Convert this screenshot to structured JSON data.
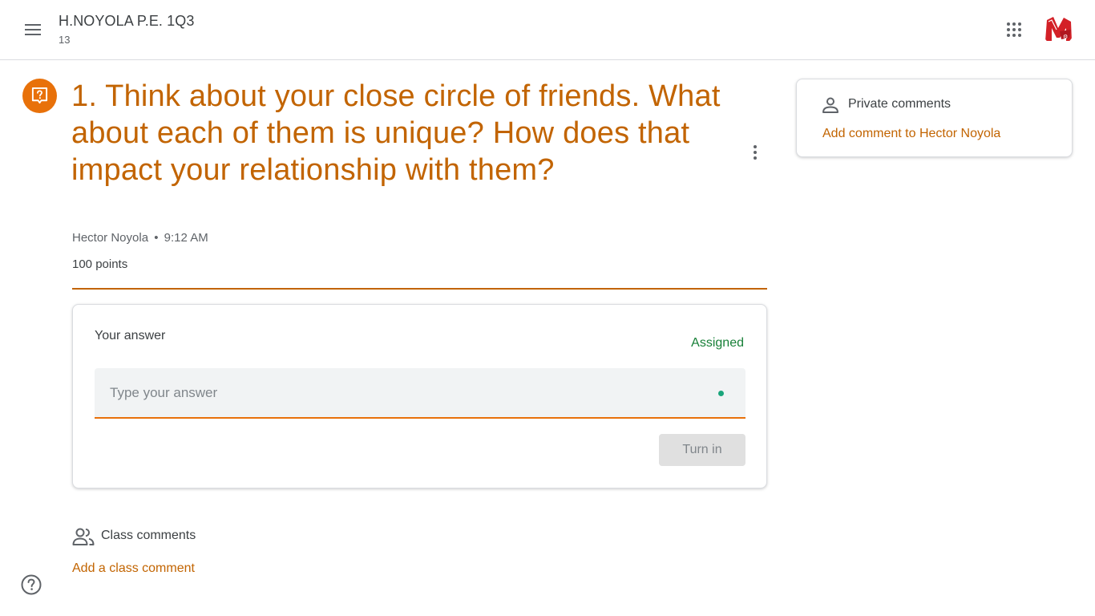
{
  "header": {
    "class_name": "H.NOYOLA P.E. 1Q3",
    "section": "13",
    "menu_icon": "menu-icon",
    "apps_icon": "apps-grid-icon",
    "avatar_icon": "user-avatar"
  },
  "assignment": {
    "icon": "question-icon",
    "title": "1. Think about your close circle of friends. What about each of them is unique? How does that impact your relationship with them?",
    "author": "Hector Noyola",
    "separator": "•",
    "time": "9:12 AM",
    "points": "100 points",
    "accent_color": "#c26401"
  },
  "answer_card": {
    "heading": "Your answer",
    "status": "Assigned",
    "status_color": "#188038",
    "input_placeholder": "Type your answer",
    "input_value": "",
    "turn_in_label": "Turn in"
  },
  "class_comments": {
    "icon": "people-icon",
    "label": "Class comments",
    "add_label": "Add a class comment"
  },
  "private_comments": {
    "icon": "person-icon",
    "label": "Private comments",
    "add_label": "Add comment to Hector Noyola"
  },
  "help": {
    "icon": "help-icon"
  }
}
